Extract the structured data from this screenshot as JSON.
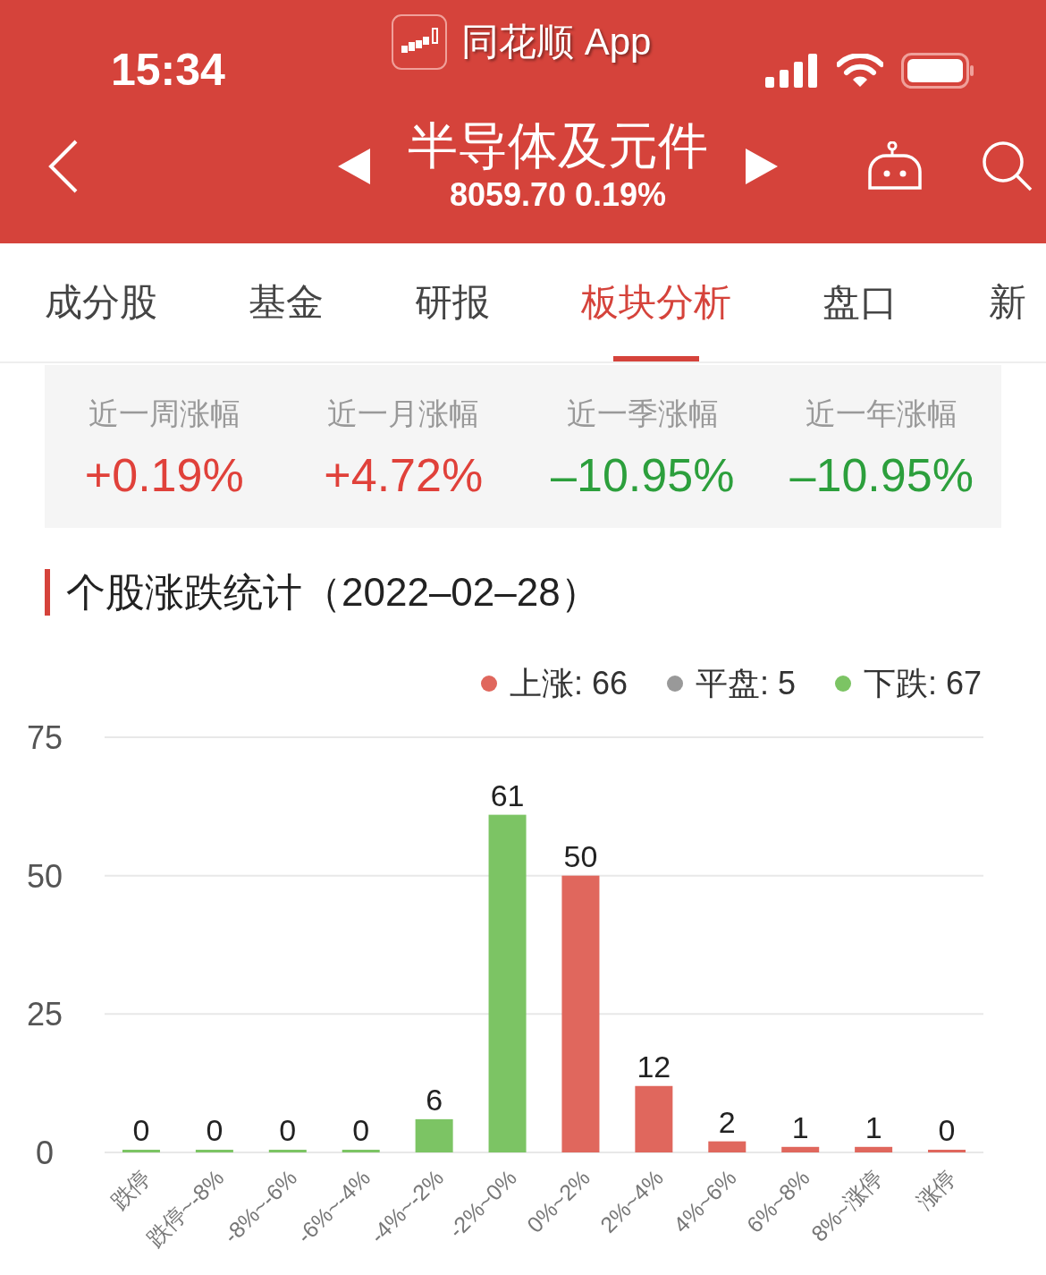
{
  "status_bar": {
    "time": "15:34",
    "app_name": "同花顺 App"
  },
  "header": {
    "title": "半导体及元件",
    "quote": "8059.70 0.19%"
  },
  "tabs": [
    {
      "label": "成分股",
      "selected": false
    },
    {
      "label": "基金",
      "selected": false
    },
    {
      "label": "研报",
      "selected": false
    },
    {
      "label": "板块分析",
      "selected": true
    },
    {
      "label": "盘口",
      "selected": false
    },
    {
      "label": "新",
      "selected": false
    }
  ],
  "stats": [
    {
      "label": "近一周涨幅",
      "value": "+0.19%",
      "color": "#e0413a"
    },
    {
      "label": "近一月涨幅",
      "value": "+4.72%",
      "color": "#e0413a"
    },
    {
      "label": "近一季涨幅",
      "value": "–10.95%",
      "color": "#2c9f3c"
    },
    {
      "label": "近一年涨幅",
      "value": "–10.95%",
      "color": "#2c9f3c"
    }
  ],
  "section_title": "个股涨跌统计（2022–02–28）",
  "legend": [
    {
      "label": "上涨: 66",
      "color": "#e0675d"
    },
    {
      "label": "平盘: 5",
      "color": "#999999"
    },
    {
      "label": "下跌: 67",
      "color": "#7cc464"
    }
  ],
  "chart_data": {
    "type": "bar",
    "categories": [
      "跌停",
      "跌停~-8%",
      "-8%~-6%",
      "-6%~-4%",
      "-4%~-2%",
      "-2%~0%",
      "0%~2%",
      "2%~4%",
      "4%~6%",
      "6%~8%",
      "8%~涨停",
      "涨停"
    ],
    "series": [
      {
        "color": "#7cc464",
        "values": [
          0,
          0,
          0,
          0,
          6,
          61,
          null,
          null,
          null,
          null,
          null,
          null
        ]
      },
      {
        "color": "#e0675d",
        "values": [
          null,
          null,
          null,
          null,
          null,
          null,
          50,
          12,
          2,
          1,
          1,
          0
        ]
      }
    ],
    "ylim": [
      0,
      75
    ],
    "yticks": [
      0,
      25,
      50,
      75
    ],
    "data_labels": true
  }
}
